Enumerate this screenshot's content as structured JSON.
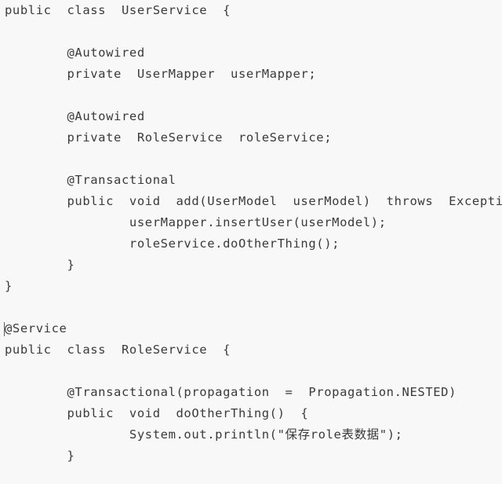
{
  "editor": {
    "language": "Java",
    "background_color": "#f8f8f8",
    "text_color": "#3a3a3a",
    "caret_color": "#5a5a5a",
    "caret_line_index": 14,
    "line_count": 22
  },
  "code": {
    "lines": [
      "public  class  UserService  {",
      "",
      "        @Autowired",
      "        private  UserMapper  userMapper;",
      "",
      "        @Autowired",
      "        private  RoleService  roleService;",
      "",
      "        @Transactional",
      "        public  void  add(UserModel  userModel)  throws  Exception  {",
      "                userMapper.insertUser(userModel);",
      "                roleService.doOtherThing();",
      "        }",
      "}",
      "",
      "@Service",
      "public  class  RoleService  {",
      "",
      "        @Transactional(propagation  =  Propagation.NESTED)",
      "        public  void  doOtherThing()  {",
      "                System.out.println(\"保存role表数据\");",
      "        }",
      "}"
    ]
  }
}
